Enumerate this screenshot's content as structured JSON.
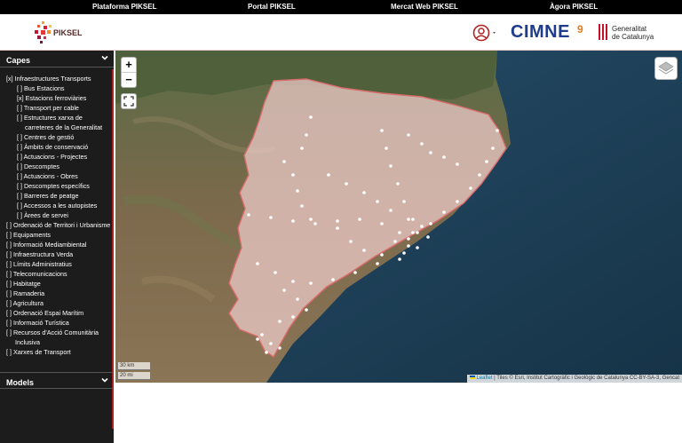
{
  "topnav": {
    "items": [
      "Plataforma PIKSEL",
      "Portal PIKSEL",
      "Mercat Web PIKSEL",
      "Àgora PIKSEL"
    ]
  },
  "header": {
    "logo_text": "PIKSEL",
    "cimne": "CIMNE",
    "cimne_mark": "9",
    "gencat_line1": "Generalitat",
    "gencat_line2": "de Catalunya"
  },
  "sidebar": {
    "capes_title": "Capes",
    "models_title": "Models",
    "items": [
      "[x] Infraestructures Transports",
      "[ ] Bus Estacions",
      "[x] Estacions ferroviàries",
      "[ ] Transport per cable",
      "[ ] Estructures xarxa de",
      "carreteres de la Generalitat",
      "[ ] Centres de gestió",
      "[ ] Àmbits de conservació",
      "[ ] Actuacions - Projectes",
      "[ ] Descomptes",
      "[ ] Actuacions - Obres",
      "[ ] Descomptes específics",
      "[ ] Barreres de peatge",
      "[ ] Accessos a les autopistes",
      "[ ] Àrees de servei",
      "[ ] Ordenació de Territori i Urbanisme",
      "[ ] Equipaments",
      "[ ] Informació Mediambiental",
      "[ ] Infraestructura Verda",
      "[ ] Límits Administratius",
      "[ ] Telecomunicacions",
      "[ ] Habitatge",
      "[ ] Ramaderia",
      "[ ] Agricultura",
      "[ ] Ordenació Espai Marítim",
      "[ ] Informació Turística",
      "[ ] Recursos d'Acció Comunitària",
      "Inclusiva",
      "[ ] Xarxes de Transport"
    ]
  },
  "map": {
    "zoom_in": "+",
    "zoom_out": "−",
    "scale_km": "30 km",
    "scale_mi": "20 mi",
    "attribution_link": "Leaflet",
    "attribution_rest": " | Tiles © Esri, Institut Cartogràfic i Geològic de Catalunya CC-BY-SA-3, Gencat"
  },
  "colors": {
    "accent": "#a92020",
    "sidebar_bg": "#1c1c1c",
    "region_fill": "#e8c7c3",
    "region_border": "#d96b6b"
  }
}
